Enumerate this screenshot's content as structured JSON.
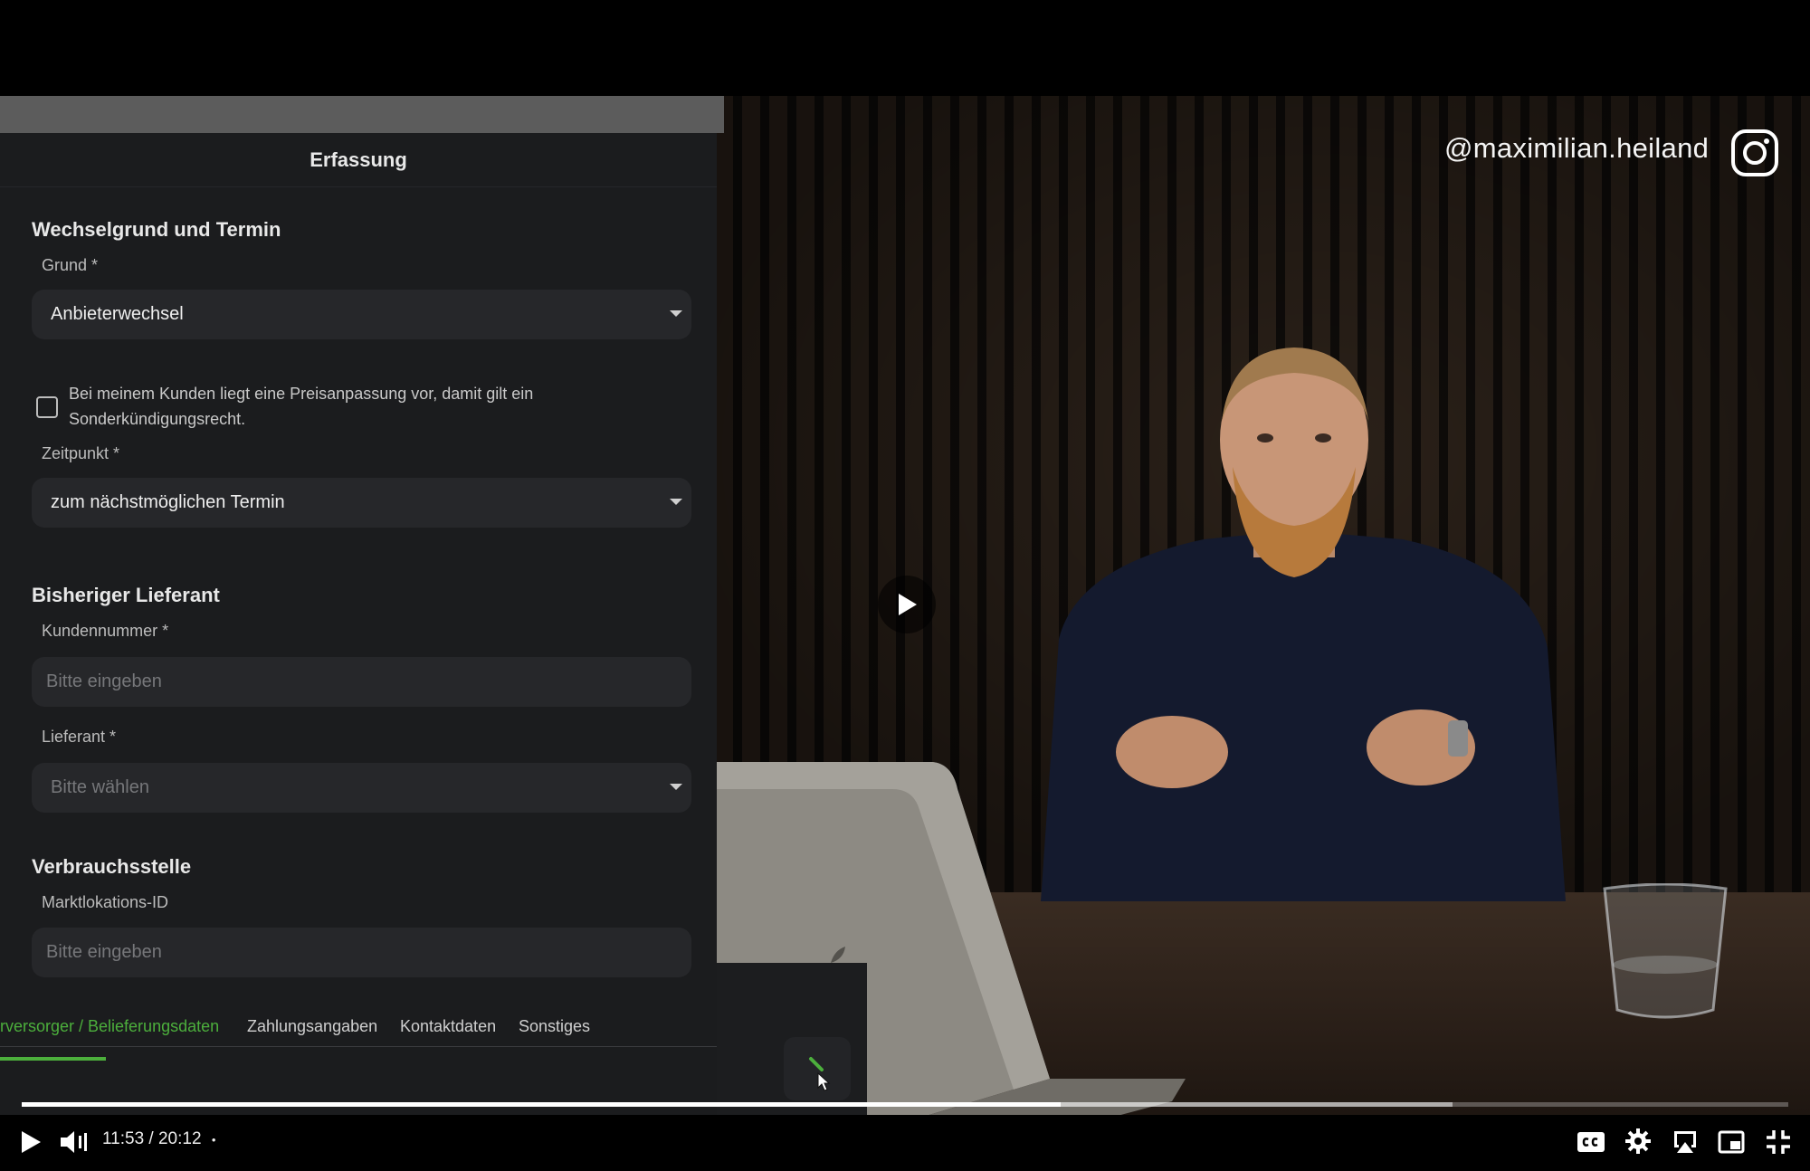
{
  "form": {
    "header": "Erfassung",
    "section1_title": "Wechselgrund und Termin",
    "grund_label": "Grund *",
    "grund_value": "Anbieterwechsel",
    "checkbox_label": "Bei meinem Kunden liegt eine Preisanpassung vor, damit gilt ein Sonderkündigungsrecht.",
    "checkbox_checked": false,
    "zeitpunkt_label": "Zeitpunkt *",
    "zeitpunkt_value": "zum nächstmöglichen Termin",
    "section2_title": "Bisheriger Lieferant",
    "kundennummer_label": "Kundennummer *",
    "kundennummer_placeholder": "Bitte eingeben",
    "lieferant_label": "Lieferant *",
    "lieferant_placeholder": "Bitte wählen",
    "section3_title": "Verbrauchsstelle",
    "marktlokation_label": "Marktlokations-ID",
    "marktlokation_placeholder": "Bitte eingeben"
  },
  "tabs": [
    {
      "label": "rversorger / Belieferungsdaten",
      "active": true
    },
    {
      "label": "Zahlungsangaben",
      "active": false
    },
    {
      "label": "Kontaktdaten",
      "active": false
    },
    {
      "label": "Sonstiges",
      "active": false
    }
  ],
  "overlay": {
    "handle": "@maximilian.heiland",
    "icon": "instagram-icon"
  },
  "player": {
    "current_time": "11:53",
    "duration": "20:12",
    "time_separator": "/",
    "dot": "•",
    "played_fraction": 0.588,
    "buffered_fraction": 0.81
  },
  "colors": {
    "accent_green": "#4caf3c",
    "form_bg": "#1b1c1e",
    "field_bg": "#26272a"
  }
}
